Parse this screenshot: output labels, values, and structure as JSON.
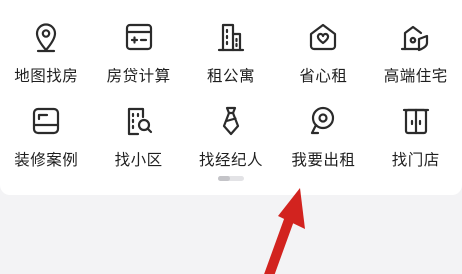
{
  "menu": {
    "items": [
      {
        "label": "地图找房",
        "icon": "map-pin-icon"
      },
      {
        "label": "房贷计算",
        "icon": "calculator-icon"
      },
      {
        "label": "租公寓",
        "icon": "apartment-building-icon"
      },
      {
        "label": "省心租",
        "icon": "heart-house-icon"
      },
      {
        "label": "高端住宅",
        "icon": "premium-residence-icon"
      },
      {
        "label": "装修案例",
        "icon": "renovation-case-icon"
      },
      {
        "label": "找小区",
        "icon": "community-search-icon"
      },
      {
        "label": "找经纪人",
        "icon": "agent-tie-icon"
      },
      {
        "label": "我要出租",
        "icon": "rent-out-key-icon"
      },
      {
        "label": "找门店",
        "icon": "storefront-icon"
      }
    ]
  },
  "colors": {
    "icon_stroke": "#2b2b2b",
    "arrow": "#d2231f",
    "card_background": "#ffffff",
    "page_background": "#f3f3f5"
  }
}
